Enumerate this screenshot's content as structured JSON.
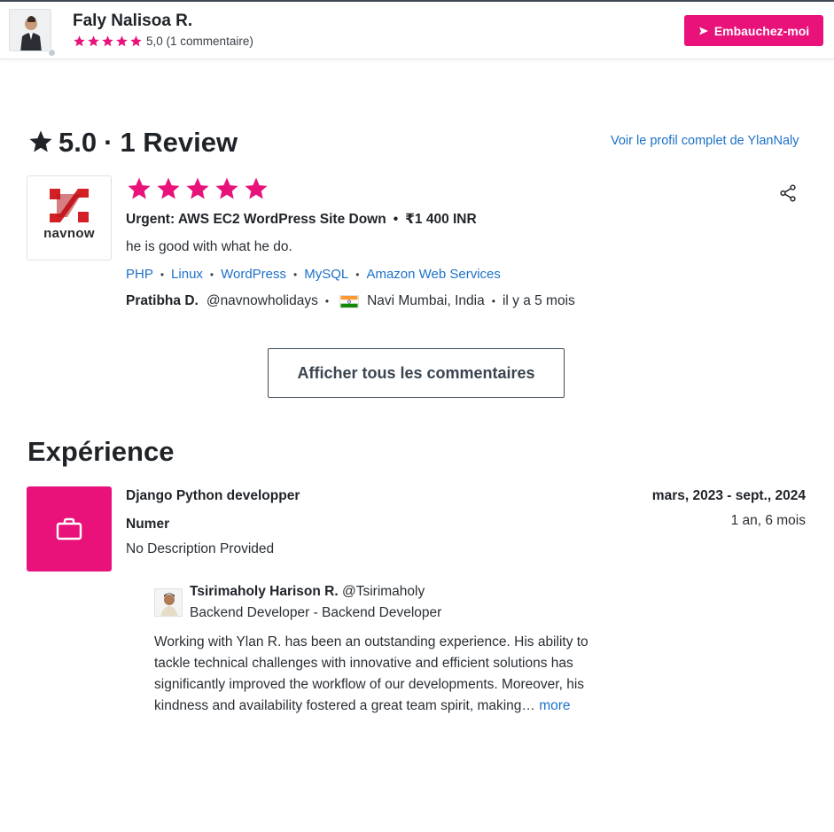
{
  "header": {
    "name": "Faly Nalisoa R.",
    "rating_value": "5,0",
    "rating_count": "(1 commentaire)",
    "hire_label": "Embauchez-moi"
  },
  "reviews": {
    "score": "5.0",
    "separator": "·",
    "count_label": "1 Review",
    "profile_link": "Voir le profil complet de YlanNaly",
    "items": [
      {
        "client_logo_text": "navnow",
        "stars": 5,
        "project": "Urgent: AWS EC2 WordPress Site Down",
        "amount": "₹1 400 INR",
        "text": "he is good with what he do.",
        "skills": [
          "PHP",
          "Linux",
          "WordPress",
          "MySQL",
          "Amazon Web Services"
        ],
        "reviewer_name": "Pratibha D.",
        "reviewer_handle": "@navnowholidays",
        "location": "Navi Mumbai, India",
        "time_ago": "il y a 5 mois"
      }
    ],
    "all_reviews_label": "Afficher tous les commentaires"
  },
  "experience": {
    "title": "Expérience",
    "items": [
      {
        "role": "Django Python developper",
        "company": "Numer",
        "description": "No Description Provided",
        "dates": "mars, 2023 - sept., 2024",
        "duration": "1 an, 6 mois",
        "recommendation": {
          "name": "Tsirimaholy Harison R.",
          "handle": "@Tsirimaholy",
          "title": "Backend Developer - Backend Developer",
          "text": "Working with Ylan R. has been an outstanding experience. His ability to tackle technical challenges with innovative and efficient solutions has significantly improved the workflow of our developments. Moreover, his kindness and availability fostered a great team spirit, making…",
          "more_label": "more"
        }
      }
    ]
  },
  "colors": {
    "accent": "#e8127a",
    "link": "#1d71c9",
    "text": "#1f2328"
  },
  "icons": [
    "star-icon",
    "send-icon",
    "share-icon",
    "briefcase-icon",
    "india-flag-icon"
  ]
}
